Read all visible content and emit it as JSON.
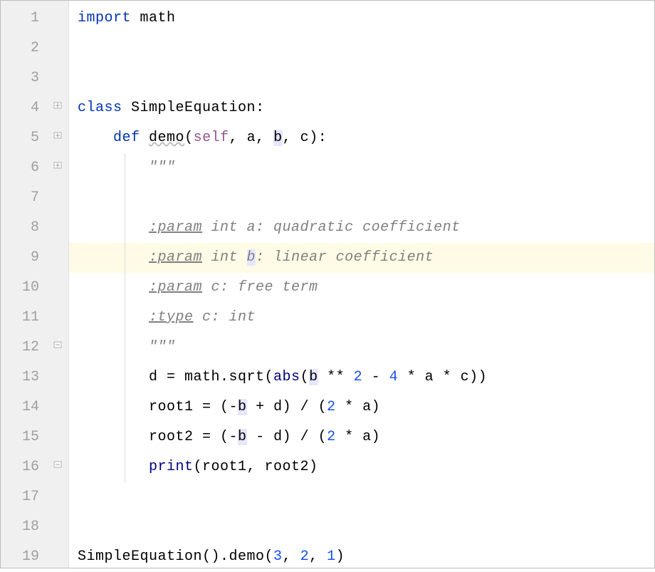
{
  "lineCount": 19,
  "highlightedLine": 9,
  "foldMarkers": [
    {
      "line": 4,
      "type": "open"
    },
    {
      "line": 5,
      "type": "open"
    },
    {
      "line": 6,
      "type": "open"
    },
    {
      "line": 12,
      "type": "close"
    },
    {
      "line": 16,
      "type": "close"
    }
  ],
  "lines": {
    "l1": {
      "import_kw": "import",
      "module": "math"
    },
    "l4": {
      "class_kw": "class",
      "name": "SimpleEquation",
      "colon": ":"
    },
    "l5": {
      "def_kw": "def",
      "name": "demo",
      "open": "(",
      "self": "self",
      "c1": ", ",
      "a": "a",
      "c2": ", ",
      "b": "b",
      "c3": ", ",
      "c": "c",
      "close": "):"
    },
    "l6": {
      "triple": "\"\"\""
    },
    "l8": {
      "tag": ":param",
      "rest": " int a: quadratic coefficient"
    },
    "l9": {
      "tag": ":param",
      "rest1": " int ",
      "b": "b",
      "rest2": ": linear coefficient"
    },
    "l10": {
      "tag": ":param",
      "rest": " c: free term"
    },
    "l11": {
      "tag": ":type",
      "rest": " c: int"
    },
    "l12": {
      "triple": "\"\"\""
    },
    "l13": {
      "pre": "d = math.sqrt(",
      "abs": "abs",
      "open": "(",
      "b": "b",
      "op1": " ** ",
      "n2": "2",
      "op2": " - ",
      "n4": "4",
      "op3": " * a * c))"
    },
    "l14": {
      "pre": "root1 = (-",
      "b": "b",
      "op1": " + d) / (",
      "n2": "2",
      "op2": " * a)"
    },
    "l15": {
      "pre": "root2 = (-",
      "b": "b",
      "op1": " - d) / (",
      "n2": "2",
      "op2": " * a)"
    },
    "l16": {
      "print": "print",
      "rest": "(root1, root2)"
    },
    "l19": {
      "call": "SimpleEquation().demo(",
      "n3": "3",
      "c1": ", ",
      "n2": "2",
      "c2": ", ",
      "n1": "1",
      "close": ")"
    }
  }
}
